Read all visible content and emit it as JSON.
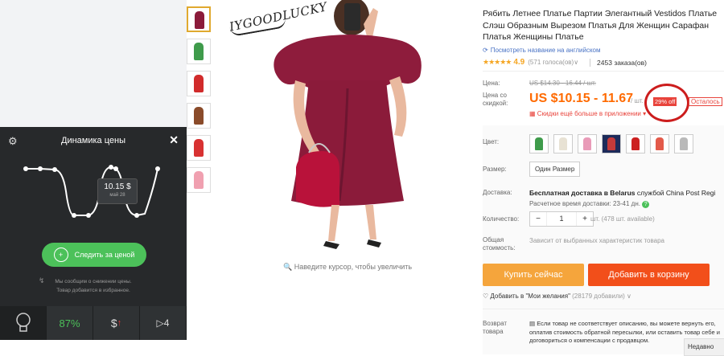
{
  "product": {
    "title": "Рябить Летнее Платье Партии Элегантный Vestidos Платье Слэш Образным Вырезом Платья Для Женщин Сарафан Платья Женщины Платье",
    "translate_link": "Посмотреть название на английском",
    "rating": "4.9",
    "rating_count": "(571 голоса(ов)",
    "orders": "2453 заказа(ов)",
    "price_label": "Цена:",
    "old_price": "US $14.30 - 16.44 / шт.",
    "discount_price_label": "Цена со скидкой:",
    "price": "US $10.15 - 11.67",
    "price_unit": "/ шт.",
    "discount": "29% off",
    "remaining": "Осталось",
    "app_offer": "Скидки ещё больше в приложении",
    "color_label": "Цвет:",
    "size_label": "Размер:",
    "size_value": "Один Размер",
    "shipping_label": "Доставка:",
    "shipping_text_bold": "Бесплатная доставка в Belarus",
    "shipping_text": " службой China Post Regi",
    "delivery_time": "Расчетное время доставки: 23-41 дн.",
    "quantity_label": "Количество:",
    "quantity": "1",
    "qty_minus": "−",
    "qty_plus": "+",
    "qty_available": "шт. (478 шт. available)",
    "total_label": "Общая стоимость:",
    "total_text": "Зависит от выбранных характеристик товара",
    "buy_now": "Купить сейчас",
    "add_to_cart": "Добавить в корзину",
    "wishlist": "Добавить в \"Мои желания\"",
    "wishlist_count": "(28179 добавили)",
    "return_label": "Возврат товара",
    "return_text": "Если товар не соответствует описанию, вы можете вернуть его, оплатив стоимость обратной пересылки, или оставить товар себе и договориться о компенсации с продавцом.",
    "brand_watermark": "IYGOODLUCKY",
    "zoom_hint": "Наведите курсор, чтобы увеличить",
    "recently_viewed": "Недавно"
  },
  "colors": {
    "accent_orange": "#ff6a00",
    "buy_now": "#f5a53c",
    "add_to_cart": "#f24f1a",
    "discount_red": "#e8433b",
    "widget_bg": "#27292b",
    "widget_green": "#4cc15a",
    "dress_main": "#8b1b3a"
  },
  "thumbnails": [
    "burgundy",
    "green",
    "red",
    "brown",
    "red",
    "pink"
  ],
  "color_swatches": [
    "green",
    "white",
    "pink",
    "navy",
    "red",
    "coral",
    "gray"
  ],
  "widget": {
    "title": "Динамика цены",
    "tooltip_price": "10.15 $",
    "tooltip_date": "май 28",
    "follow_button": "Следить за ценой",
    "note_line1": "Мы сообщим о снижении цены.",
    "note_line2": "Товар добавится в избранное.",
    "footer_percent": "87%",
    "footer_dollar": "$",
    "footer_play": "4"
  }
}
